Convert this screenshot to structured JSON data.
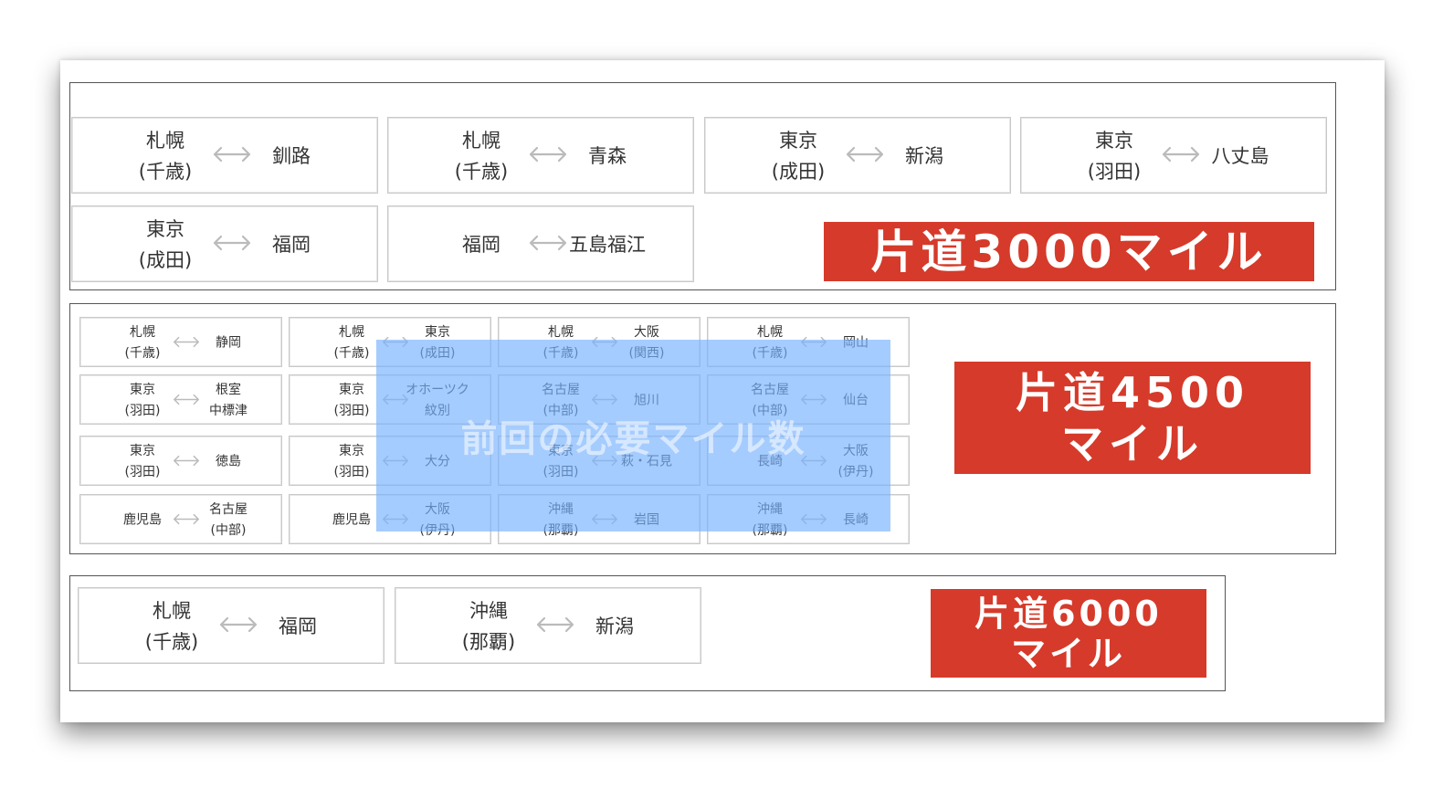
{
  "groups": [
    {
      "routes": [
        {
          "from": "札幌",
          "from_sub": "(千歳)",
          "to": "釧路",
          "to_sub": ""
        },
        {
          "from": "札幌",
          "from_sub": "(千歳)",
          "to": "青森",
          "to_sub": ""
        },
        {
          "from": "東京",
          "from_sub": "(成田)",
          "to": "新潟",
          "to_sub": ""
        },
        {
          "from": "東京",
          "from_sub": "(羽田)",
          "to": "八丈島",
          "to_sub": ""
        },
        {
          "from": "東京",
          "from_sub": "(成田)",
          "to": "福岡",
          "to_sub": ""
        },
        {
          "from": "福岡",
          "from_sub": "",
          "to": "五島福江",
          "to_sub": ""
        }
      ],
      "banner": {
        "line1": "片道3000マイル",
        "line2": ""
      }
    },
    {
      "routes": [
        {
          "from": "札幌",
          "from_sub": "(千歳)",
          "to": "静岡",
          "to_sub": ""
        },
        {
          "from": "札幌",
          "from_sub": "(千歳)",
          "to": "東京",
          "to_sub": "(成田)"
        },
        {
          "from": "札幌",
          "from_sub": "(千歳)",
          "to": "大阪",
          "to_sub": "(関西)"
        },
        {
          "from": "札幌",
          "from_sub": "(千歳)",
          "to": "岡山",
          "to_sub": ""
        },
        {
          "from": "東京",
          "from_sub": "(羽田)",
          "to": "根室",
          "to_sub": "中標津"
        },
        {
          "from": "東京",
          "from_sub": "(羽田)",
          "to": "オホーツク",
          "to_sub": "紋別"
        },
        {
          "from": "名古屋",
          "from_sub": "(中部)",
          "to": "旭川",
          "to_sub": ""
        },
        {
          "from": "名古屋",
          "from_sub": "(中部)",
          "to": "仙台",
          "to_sub": ""
        },
        {
          "from": "東京",
          "from_sub": "(羽田)",
          "to": "徳島",
          "to_sub": ""
        },
        {
          "from": "東京",
          "from_sub": "(羽田)",
          "to": "大分",
          "to_sub": ""
        },
        {
          "from": "東京",
          "from_sub": "(羽田)",
          "to": "萩・石見",
          "to_sub": ""
        },
        {
          "from": "長崎",
          "from_sub": "",
          "to": "大阪",
          "to_sub": "(伊丹)"
        },
        {
          "from": "鹿児島",
          "from_sub": "",
          "to": "名古屋",
          "to_sub": "(中部)"
        },
        {
          "from": "鹿児島",
          "from_sub": "",
          "to": "大阪",
          "to_sub": "(伊丹)"
        },
        {
          "from": "沖縄",
          "from_sub": "(那覇)",
          "to": "岩国",
          "to_sub": ""
        },
        {
          "from": "沖縄",
          "from_sub": "(那覇)",
          "to": "長崎",
          "to_sub": ""
        }
      ],
      "banner": {
        "line1": "片道4500",
        "line2": "マイル"
      }
    },
    {
      "routes": [
        {
          "from": "札幌",
          "from_sub": "(千歳)",
          "to": "福岡",
          "to_sub": ""
        },
        {
          "from": "沖縄",
          "from_sub": "(那覇)",
          "to": "新潟",
          "to_sub": ""
        }
      ],
      "banner": {
        "line1": "片道6000",
        "line2": "マイル"
      }
    }
  ],
  "overlay": {
    "label": "前回の必要マイル数"
  },
  "colors": {
    "banner_red": "#d63a2a",
    "overlay_blue": "#76b2ff",
    "arrow_gray": "#bbbbbb"
  },
  "icons": {
    "route_arrow": "double-arrow-icon"
  }
}
